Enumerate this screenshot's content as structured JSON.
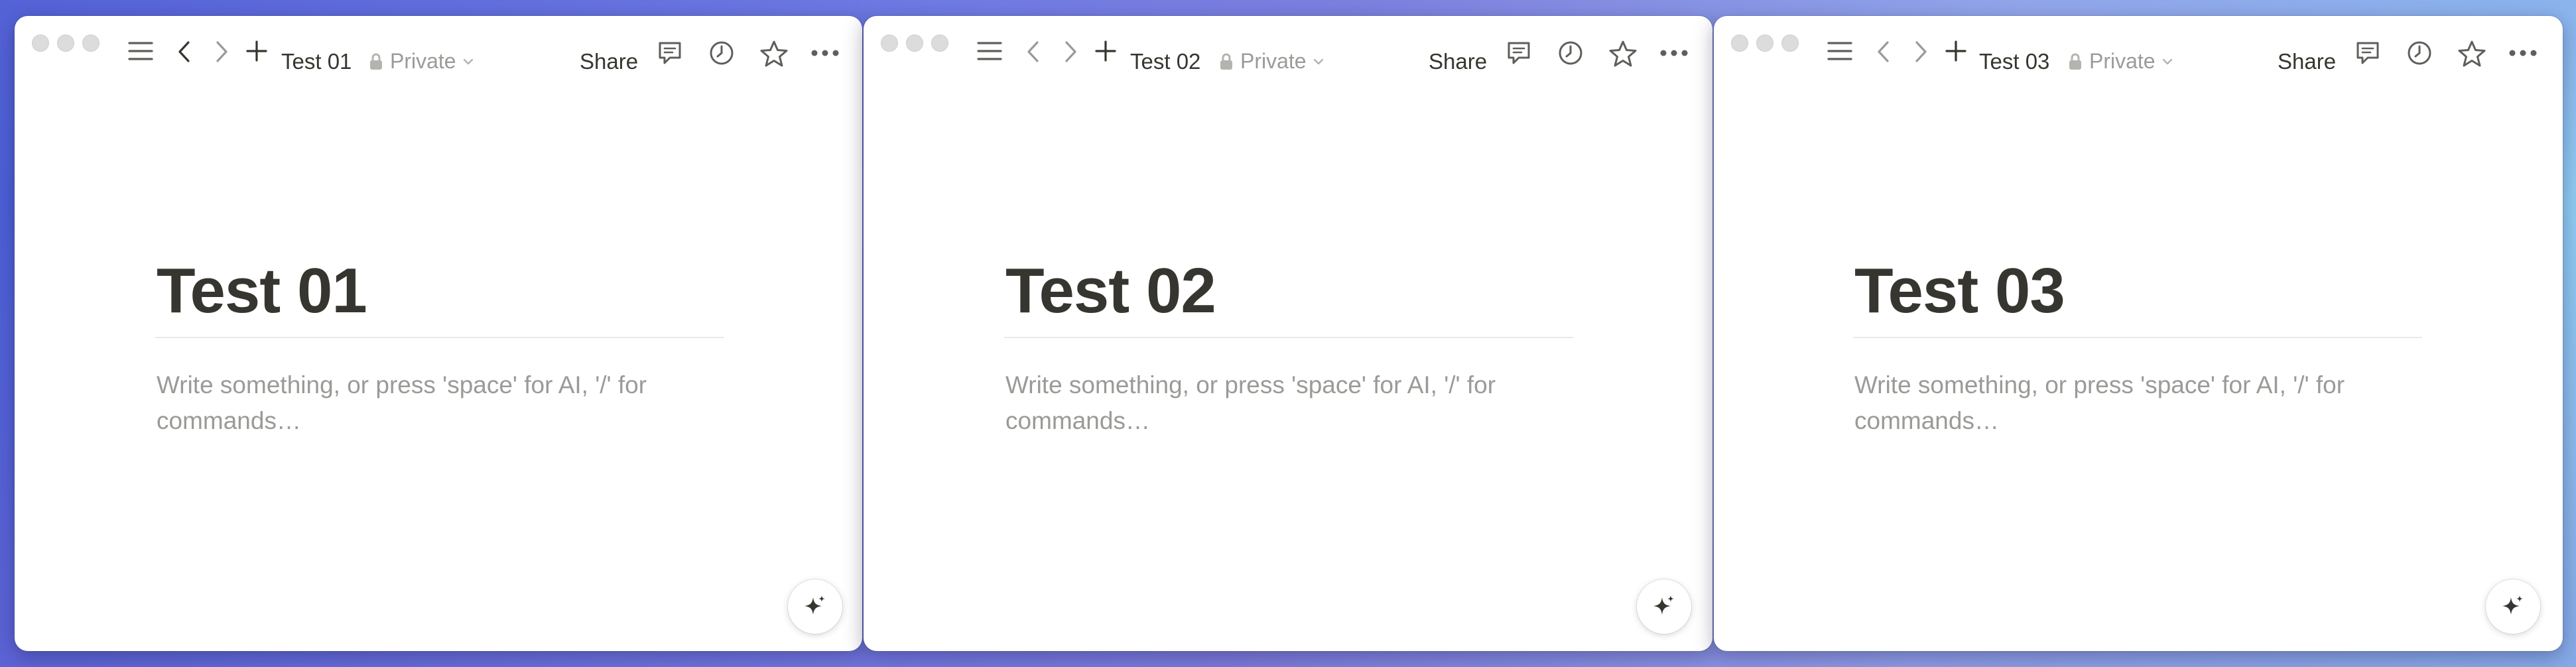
{
  "windows": [
    {
      "tab_title": "Test 01",
      "privacy": "Private",
      "share_label": "Share",
      "page_title": "Test 01",
      "placeholder": "Write something, or press 'space' for AI, '/' for commands…"
    },
    {
      "tab_title": "Test 02",
      "privacy": "Private",
      "share_label": "Share",
      "page_title": "Test 02",
      "placeholder": "Write something, or press 'space' for AI, '/' for commands…"
    },
    {
      "tab_title": "Test 03",
      "privacy": "Private",
      "share_label": "Share",
      "page_title": "Test 03",
      "placeholder": "Write something, or press 'space' for AI, '/' for commands…"
    }
  ],
  "icons": {
    "sidebar": "hamburger-menu-icon",
    "back": "chevron-left-icon",
    "forward": "chevron-right-icon",
    "new_page": "plus-icon",
    "lock": "lock-icon",
    "dropdown": "chevron-down-icon",
    "comments": "comment-icon",
    "updates": "clock-icon",
    "favorite": "star-icon",
    "more": "more-dots-icon",
    "ai": "sparkle-icon"
  },
  "colors": {
    "text": "#37352f",
    "muted": "#9b9a97",
    "divider": "#e9e9e7"
  }
}
